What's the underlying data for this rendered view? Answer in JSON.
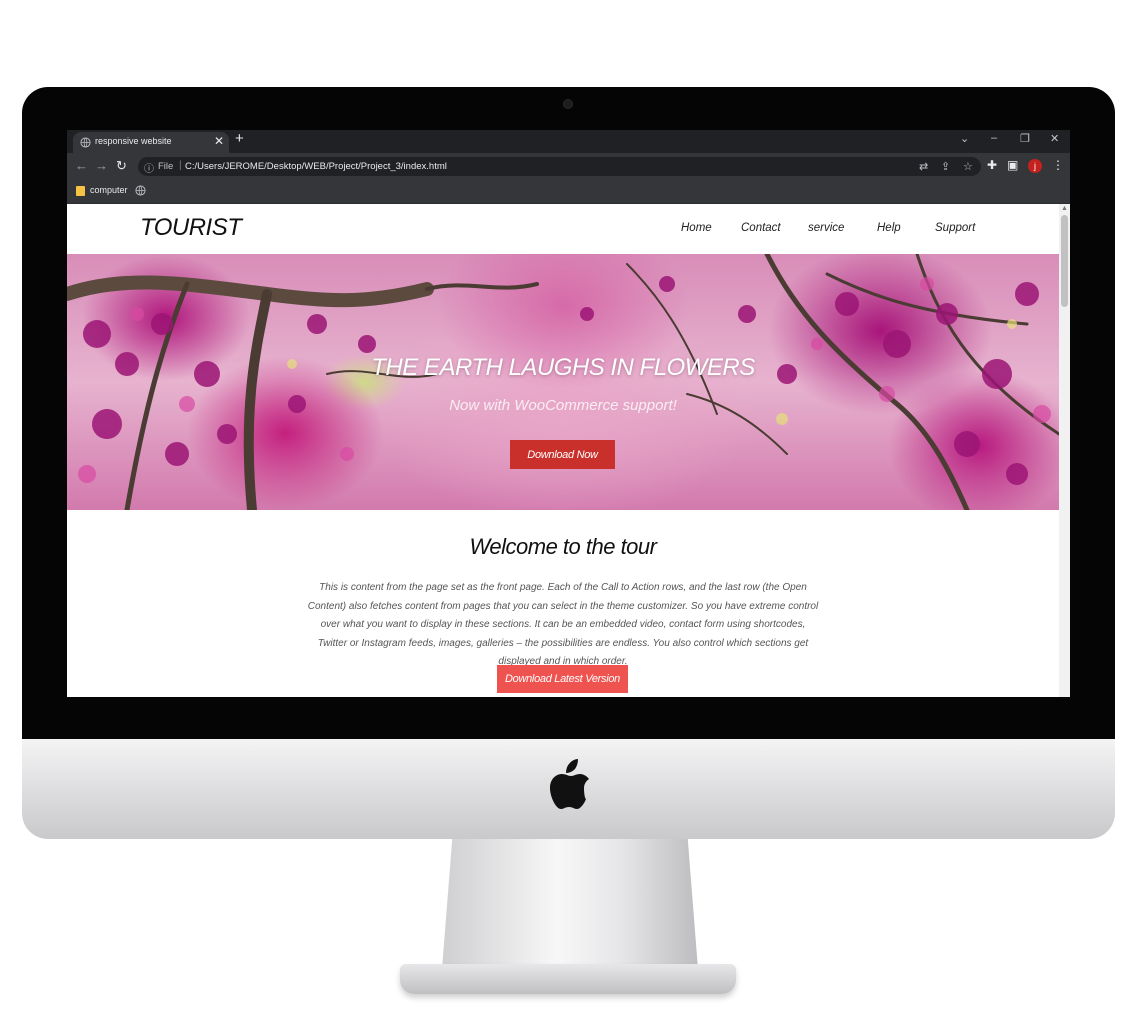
{
  "browser": {
    "tab_title": "responsive website",
    "tab_close": "✕",
    "new_tab": "+",
    "window_controls": {
      "dropdown": "⌄",
      "minimize": "–",
      "restore": "❐",
      "close": "✕"
    },
    "nav": {
      "back": "←",
      "forward": "→",
      "reload": "↻"
    },
    "address": {
      "info_icon": "ⓘ",
      "scheme": "File",
      "separator": "|",
      "url": "C:/Users/JEROME/Desktop/WEB/Project/Project_3/index.html"
    },
    "toolbar_icons": {
      "translate": "⇄",
      "share": "⇪",
      "bookmark": "☆",
      "extensions": "✚",
      "side_panel": "▣",
      "menu": "⋮"
    },
    "profile_initial": "j",
    "bookmarks": [
      {
        "label": "computer"
      }
    ]
  },
  "site": {
    "logo": "TOURIST",
    "nav": [
      "Home",
      "Contact",
      "service",
      "Help",
      "Support"
    ],
    "hero": {
      "title": "THE EARTH LAUGHS IN FLOWERS",
      "subtitle": "Now with WooCommerce support!",
      "button": "Download Now"
    },
    "welcome": {
      "title": "Welcome to the tour",
      "body": "This is content from the page set as the front page. Each of the Call to Action rows, and the last row (the Open Content) also fetches content from pages that you can select in the theme customizer. So you have extreme control over what you want to display in these sections. It can be an embedded video, contact form using shortcodes, Twitter or Instagram feeds, images, galleries – the possibilities are endless. You also control which sections get displayed and in which order.",
      "button": "Download Latest Version"
    }
  },
  "colors": {
    "hero_button": "#c9302c",
    "download_button": "#ef5350",
    "browser_dark": "#202124",
    "profile": "#c5221f"
  }
}
